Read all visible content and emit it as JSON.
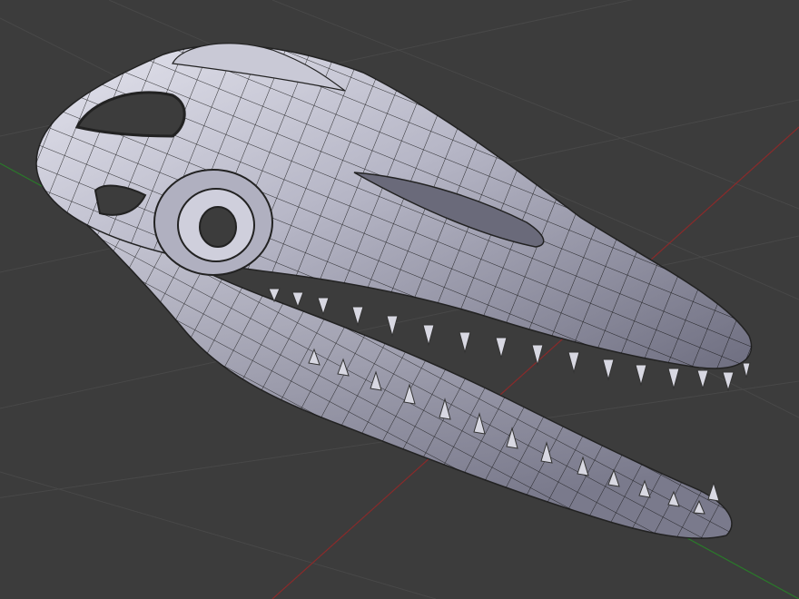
{
  "viewport": {
    "background": "#3c3c3c",
    "grid_color": "#4a4a4a",
    "x_axis_color": "#8a2a2a",
    "y_axis_color": "#2a7a2a",
    "model": {
      "object": "skull-mesh",
      "shading": "solid",
      "wire_overlay": true,
      "surface_color": "#b8b8c8",
      "wire_color": "#111111"
    }
  }
}
